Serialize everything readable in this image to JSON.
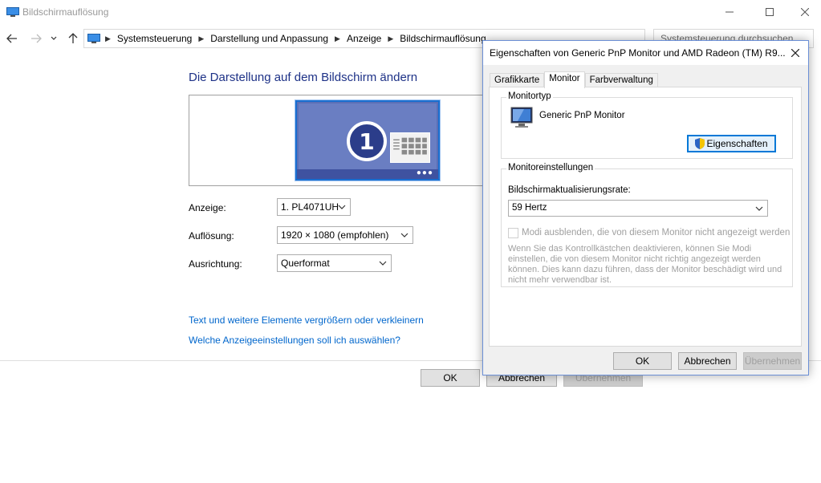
{
  "window": {
    "title": "Bildschirmauflösung"
  },
  "addressbar": {
    "breadcrumbs": [
      "Systemsteuerung",
      "Darstellung und Anpassung",
      "Anzeige",
      "Bildschirmauflösung"
    ],
    "search_placeholder": "Systemsteuerung durchsuchen"
  },
  "main": {
    "heading": "Die Darstellung auf dem Bildschirm ändern",
    "monitor_number": "1",
    "fields": {
      "anzeige_label": "Anzeige:",
      "anzeige_value": "1. PL4071UH",
      "aufloesung_label": "Auflösung:",
      "aufloesung_value": "1920 × 1080 (empfohlen)",
      "ausrichtung_label": "Ausrichtung:",
      "ausrichtung_value": "Querformat"
    },
    "links": {
      "text_size": "Text und weitere Elemente vergrößern oder verkleinern",
      "which_settings": "Welche Anzeigeeinstellungen soll ich auswählen?"
    },
    "buttons": {
      "ok": "OK",
      "cancel": "Abbrechen",
      "apply": "Übernehmen"
    }
  },
  "dialog": {
    "title": "Eigenschaften von Generic PnP Monitor und AMD Radeon (TM) R9...",
    "tabs": [
      "Grafikkarte",
      "Monitor",
      "Farbverwaltung"
    ],
    "active_tab": "Monitor",
    "monitortyp": {
      "group_label": "Monitortyp",
      "monitor_name": "Generic PnP Monitor",
      "properties_button": "Eigenschaften"
    },
    "settings": {
      "group_label": "Monitoreinstellungen",
      "refresh_label": "Bildschirmaktualisierungsrate:",
      "refresh_value": "59 Hertz",
      "hide_modes_label": "Modi ausblenden, die von diesem Monitor nicht angezeigt werden",
      "hide_modes_checked": false,
      "description": "Wenn Sie das Kontrollkästchen deaktivieren, können Sie Modi einstellen, die von diesem Monitor nicht richtig angezeigt werden können. Dies kann dazu führen, dass der Monitor beschädigt wird und nicht mehr verwendbar ist."
    },
    "buttons": {
      "ok": "OK",
      "cancel": "Abbrechen",
      "apply": "Übernehmen"
    }
  },
  "colors": {
    "heading": "#1e3287",
    "link": "#0066cc",
    "accent": "#1a6fd0"
  }
}
